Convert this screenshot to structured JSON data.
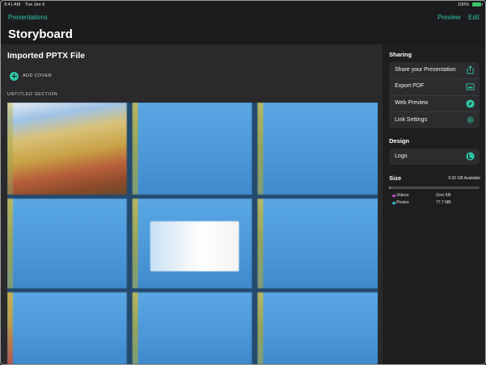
{
  "status_bar": {
    "time": "9:41 AM",
    "date": "Tue Jan 9",
    "battery_pct": "100%"
  },
  "nav": {
    "back_label": "Presentations",
    "preview_label": "Preview",
    "edit_label": "Edit",
    "title": "Storyboard"
  },
  "main": {
    "heading": "Imported PPTX File",
    "add_cover_label": "ADD COVER",
    "section_label": "UNTITLED SECTION",
    "slide_count": 9
  },
  "sidebar": {
    "sharing_heading": "Sharing",
    "sharing_items": [
      {
        "label": "Share your Presentation",
        "icon": "share-icon"
      },
      {
        "label": "Export PDF",
        "icon": "pdf-icon"
      },
      {
        "label": "Web Preview",
        "icon": "compass-icon"
      },
      {
        "label": "Link Settings",
        "icon": "gear-icon"
      }
    ],
    "design_heading": "Design",
    "design_items": [
      {
        "label": "Logo",
        "icon": "logo-icon"
      }
    ],
    "size_heading": "Size",
    "available": "9.92 GB Available",
    "storage_used_fraction": 0.02,
    "legend": [
      {
        "name": "Videos",
        "value": "Zero KB",
        "color": "#d04fd6"
      },
      {
        "name": "Photos",
        "value": "77.7 MB",
        "color": "#2fc7d0"
      }
    ]
  },
  "colors": {
    "accent": "#2fc7a6",
    "background": "#1c1c1e",
    "panel": "#2a2a2d"
  }
}
